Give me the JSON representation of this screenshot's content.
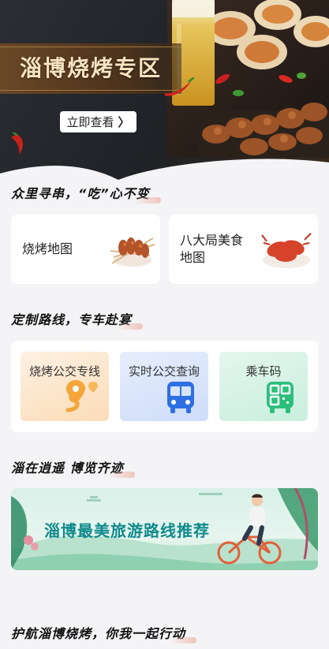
{
  "hero": {
    "title": "淄博烧烤专区",
    "view_button": "立即查看",
    "chevron": "〉"
  },
  "section1": {
    "heading": "众里寻串，“吃”心不变",
    "cards": [
      {
        "label": "烧烤地图",
        "icon": "skewers-icon"
      },
      {
        "label_line1": "八大局美食",
        "label_line2": "地图",
        "icon": "crayfish-icon"
      }
    ]
  },
  "section2": {
    "heading": "定制路线，专车赴宴",
    "tiles": [
      {
        "label": "烧烤公交专线",
        "icon": "route-pin-icon",
        "color": "#fdebd6"
      },
      {
        "label": "实时公交查询",
        "icon": "bus-icon",
        "color": "#dfe9fb"
      },
      {
        "label": "乘车码",
        "icon": "bus-code-icon",
        "color": "#dbf3ea"
      }
    ]
  },
  "section3": {
    "heading": "淄在逍遥 博览齐迹",
    "banner_text": "淄博最美旅游路线推荐"
  },
  "section4": {
    "heading": "护航淄博烧烤，你我一起行动"
  },
  "colors": {
    "accent_teal": "#0f8a8c",
    "accent_orange": "#f5a53a",
    "accent_blue": "#2f6fe4",
    "accent_green": "#2cbf7c"
  }
}
